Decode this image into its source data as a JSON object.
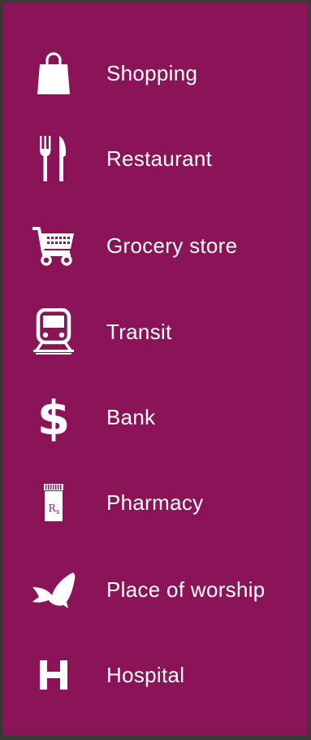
{
  "colors": {
    "background": "#8b1459",
    "text": "#ffffff",
    "border": "#3a3a3a"
  },
  "items": [
    {
      "label": "Shopping",
      "icon": "shopping-bag-icon"
    },
    {
      "label": "Restaurant",
      "icon": "fork-knife-icon"
    },
    {
      "label": "Grocery store",
      "icon": "shopping-cart-icon"
    },
    {
      "label": "Transit",
      "icon": "train-icon"
    },
    {
      "label": "Bank",
      "icon": "dollar-sign-icon"
    },
    {
      "label": "Pharmacy",
      "icon": "pill-bottle-icon"
    },
    {
      "label": "Place of worship",
      "icon": "dove-icon"
    },
    {
      "label": "Hospital",
      "icon": "hospital-h-icon"
    }
  ]
}
